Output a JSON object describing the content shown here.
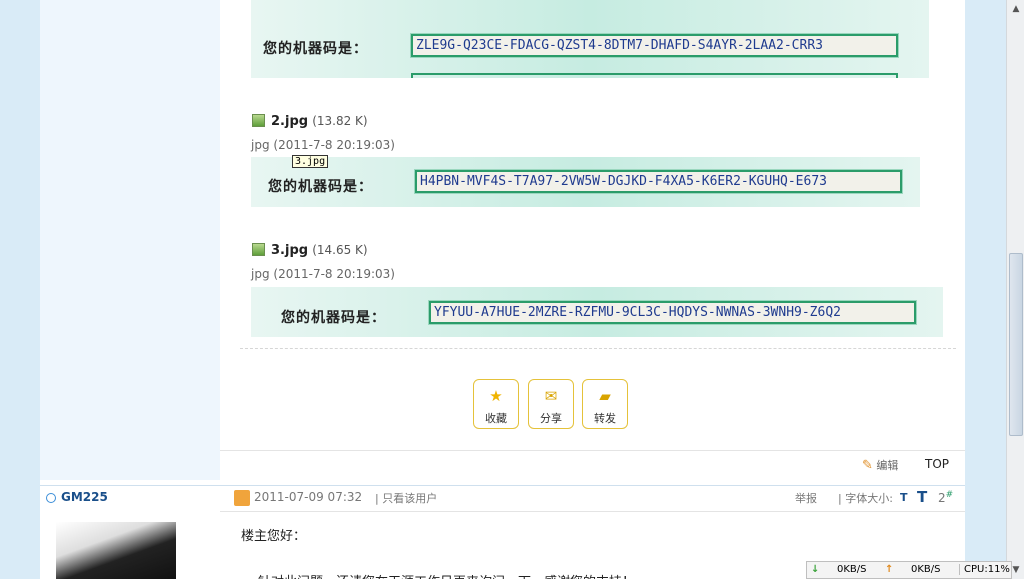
{
  "attachments": {
    "label": "您的机器码是：",
    "img1_code": "ZLE9G-Q23CE-FDACG-QZST4-8DTM7-DHAFD-S4AYR-2LAA2-CRR3",
    "file2": {
      "name": "2.jpg",
      "size": "(13.82 K)",
      "meta": "jpg",
      "date": "(2011-7-8 20:19:03)"
    },
    "tooltip": "3.jpg",
    "img2_code": "H4PBN-MVF4S-T7A97-2VW5W-DGJKD-F4XA5-K6ER2-KGUHQ-E673",
    "file3": {
      "name": "3.jpg",
      "size": "(14.65 K)",
      "meta": "jpg",
      "date": "(2011-7-8 20:19:03)"
    },
    "img3_code": "YFYUU-A7HUE-2MZRE-RZFMU-9CL3C-HQDYS-NWNAS-3WNH9-Z6Q2"
  },
  "actions": {
    "favorite": "收藏",
    "share": "分享",
    "forward": "转发"
  },
  "post_footer": {
    "edit": "编辑",
    "top": "TOP"
  },
  "next_post": {
    "username": "GM225",
    "date": "2011-07-09 07:32",
    "only_user": "| 只看该用户",
    "report": "举报",
    "font_size": "| 字体大小:",
    "t_small": "T",
    "t_large": "T",
    "floor": "2",
    "floor_mark": "#",
    "greeting": "楼主您好：",
    "body_line": "针对此问题，还请您在天涯工作日再来询问一下，感谢您的支持！"
  },
  "statusbar": {
    "down": "0KB/S",
    "up": "0KB/S",
    "cpu": "CPU:11%"
  },
  "colors": {
    "accent": "#2b9c6a",
    "link": "#1a4f8a",
    "button_border": "#e5c23a"
  }
}
